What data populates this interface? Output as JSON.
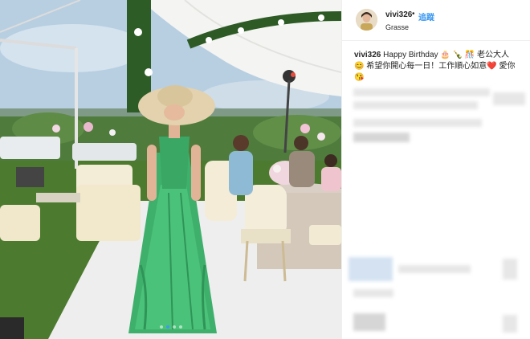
{
  "post": {
    "username": "vivi326",
    "follow_separator": "•",
    "follow_label": "追蹤",
    "location": "Grasse"
  },
  "caption": {
    "username": "vivi326",
    "line1": "Happy Birthday 🎂 🍾 🎊 老公大人",
    "line2": "😊 希望你開心每一日！工作順心如意❤️ 愛你",
    "line3": "😘"
  },
  "carousel": {
    "count": 4,
    "active_index": 1
  },
  "colors": {
    "accent": "#3897f0",
    "dress": "#3fb06c",
    "text": "#262626"
  }
}
